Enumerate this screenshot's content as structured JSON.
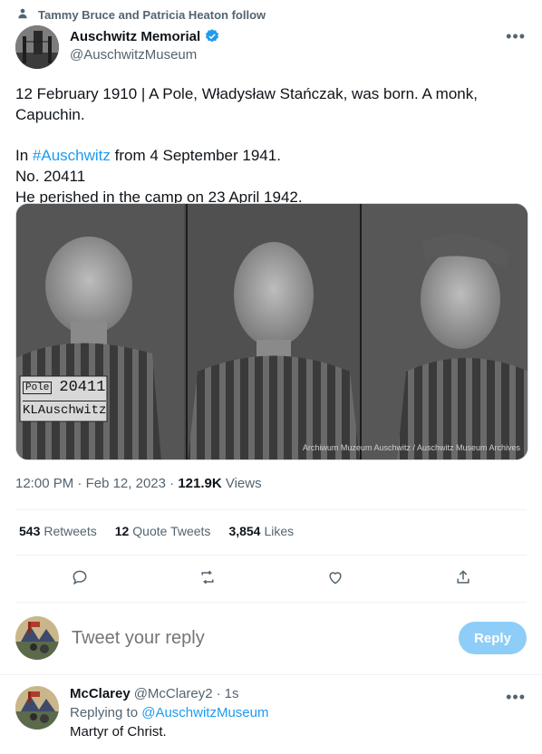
{
  "social_context": {
    "text": "Tammy Bruce and Patricia Heaton follow",
    "icon": "person-icon"
  },
  "author": {
    "name": "Auschwitz Memorial",
    "handle": "@AuschwitzMuseum",
    "verified_icon": "verified-badge-icon"
  },
  "tweet": {
    "line1": "12 February 1910 | A Pole, Władysław Stańczak, was born. A monk,",
    "line2": "Capuchin.",
    "line3_prefix": "In ",
    "hashtag": "#Auschwitz",
    "line3_suffix": " from 4 September 1941.",
    "line4": "No. 20411",
    "line5": "He perished in the camp on 23 April 1942."
  },
  "photo": {
    "placard_pole": "Pole",
    "placard_number": "20411",
    "placard_camp": "KLAuschwitz",
    "watermark": "Archiwum Muzeum Auschwitz / Auschwitz Museum Archives"
  },
  "meta": {
    "time": "12:00 PM",
    "date": "Feb 12, 2023",
    "views_count": "121.9K",
    "views_label": "Views"
  },
  "stats": {
    "retweets_count": "543",
    "retweets_label": "Retweets",
    "quotes_count": "12",
    "quotes_label": "Quote Tweets",
    "likes_count": "3,854",
    "likes_label": "Likes"
  },
  "actions": [
    "reply-icon",
    "retweet-icon",
    "like-icon",
    "share-icon"
  ],
  "reply_box": {
    "placeholder": "Tweet your reply",
    "button": "Reply"
  },
  "reply": {
    "name": "McClarey",
    "handle": "@McClarey2",
    "time": "1s",
    "replying_prefix": "Replying to ",
    "replying_handle": "@AuschwitzMuseum",
    "text": "Martyr of Christ."
  },
  "colors": {
    "accent": "#1d9bf0",
    "text": "#0f1419",
    "muted": "#536471",
    "reply_button": "#8ecdf7"
  }
}
